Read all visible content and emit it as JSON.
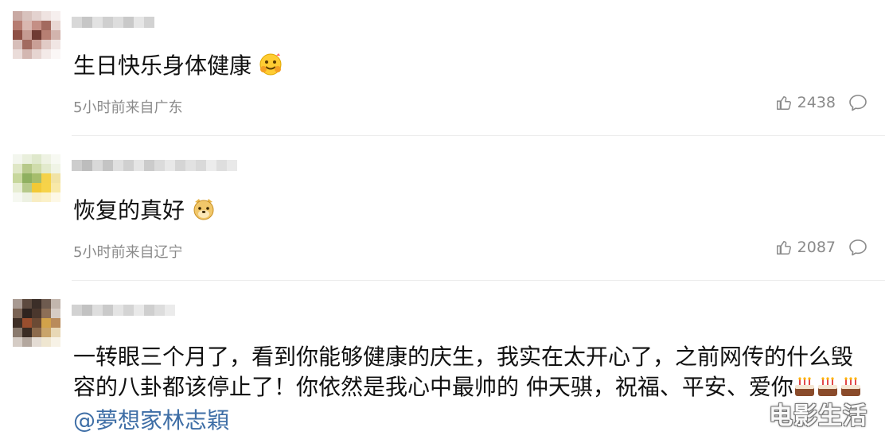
{
  "comments": [
    {
      "text": "生日快乐身体健康",
      "meta": "5小时前来自广东",
      "likes": "2438",
      "emoji": "hug-emoji"
    },
    {
      "text": "恢复的真好",
      "meta": "5小时前来自辽宁",
      "likes": "2087",
      "emoji": "doge-emoji"
    },
    {
      "text": "一转眼三个月了，看到你能够健康的庆生，我实在太开心了，之前网传的什么毁容的八卦都该停止了！你依然是我心中最帅的 仲天骐，祝福、平安、爱你",
      "mention": "@夢想家林志穎",
      "emoji": "cake-emoji"
    }
  ],
  "watermark": "电影生活",
  "colors": {
    "link": "#3e6ea6",
    "meta": "#8a8a8a"
  }
}
